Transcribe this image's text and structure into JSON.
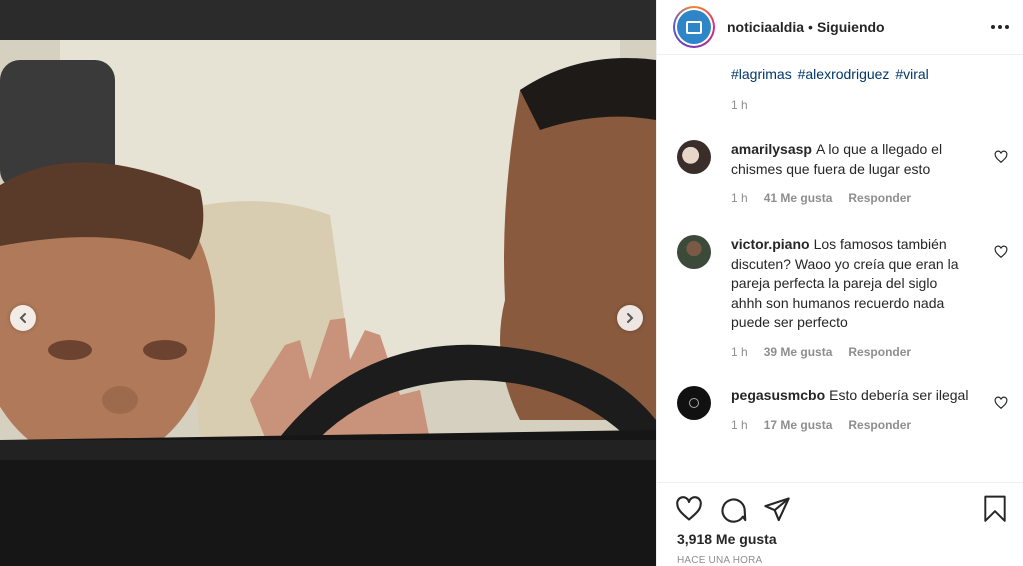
{
  "post": {
    "username": "noticiaaldia",
    "separator": "•",
    "follow_status": "Siguiendo",
    "hashtags": [
      "#lagrimas",
      "#alexrodriguez",
      "#viral"
    ],
    "caption_time": "1 h",
    "likes": "3,918 Me gusta",
    "posted_ago": "HACE UNA HORA"
  },
  "comments": [
    {
      "username": "amarilysasp",
      "text": "A lo que a llegado el chismes que fuera de lugar esto",
      "time": "1 h",
      "likes": "41 Me gusta",
      "reply": "Responder"
    },
    {
      "username": "victor.piano",
      "text": "Los famosos también discuten? Waoo yo creía que eran la pareja perfecta la pareja del siglo ahhh son humanos recuerdo nada puede ser perfecto",
      "time": "1 h",
      "likes": "39 Me gusta",
      "reply": "Responder"
    },
    {
      "username": "pegasusmcbo",
      "text": "Esto debería ser ilegal",
      "time": "1 h",
      "likes": "17 Me gusta",
      "reply": "Responder"
    }
  ],
  "colors": {
    "brand_avatar": "#2e86c8",
    "link": "#00376b",
    "muted": "#8e8e8e"
  },
  "icons": [
    "chevron-left-icon",
    "chevron-right-icon",
    "more-options-icon",
    "heart-icon",
    "comment-icon",
    "share-icon",
    "bookmark-icon"
  ]
}
